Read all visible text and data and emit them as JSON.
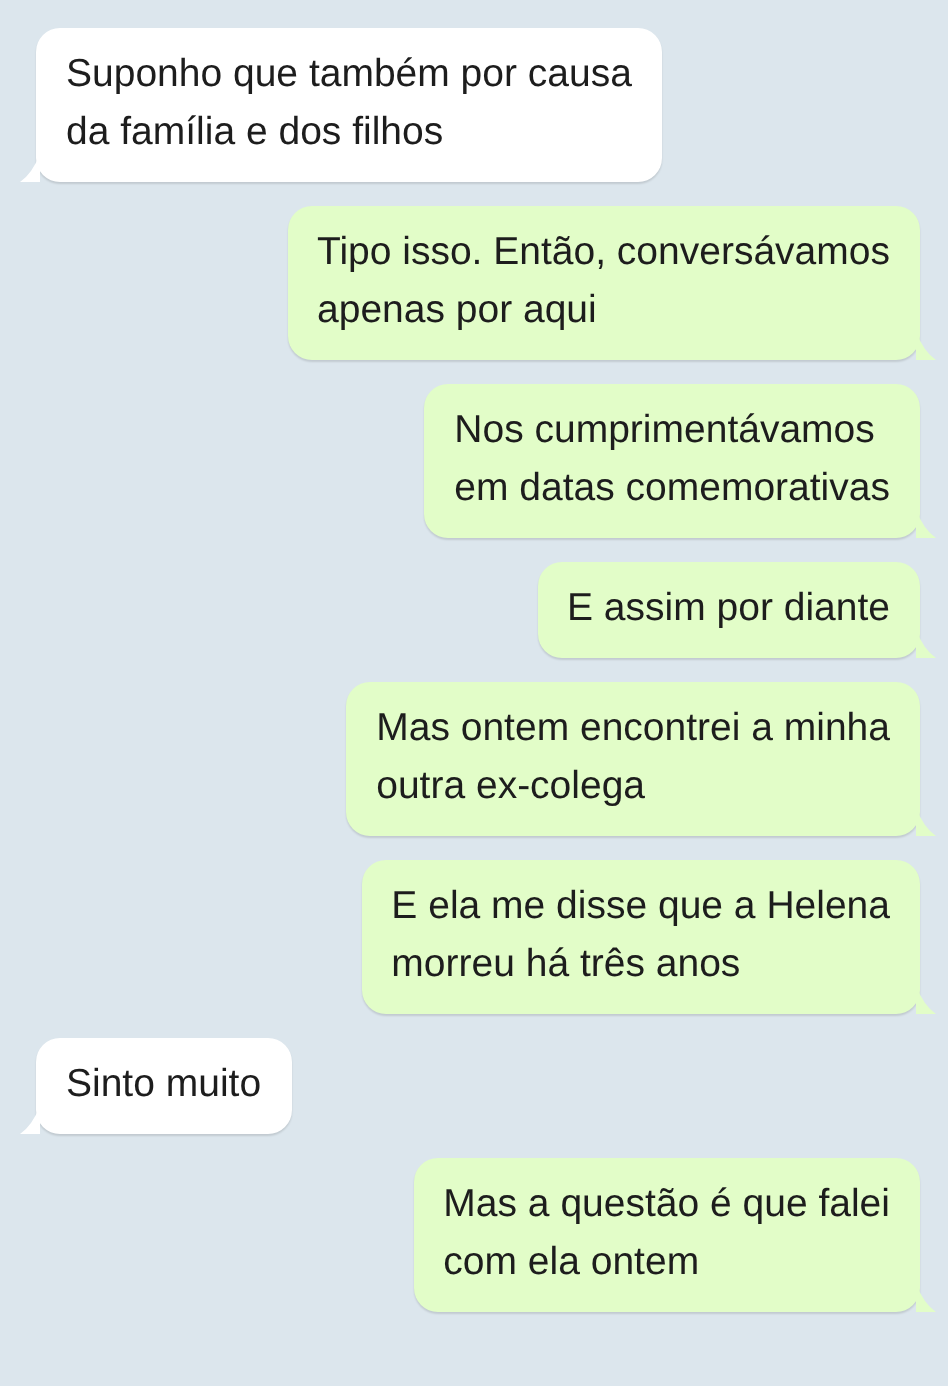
{
  "messages": [
    {
      "kind": "incoming",
      "text": "Suponho que também por causa\nda família e dos filhos"
    },
    {
      "kind": "outgoing",
      "text": "Tipo isso. Então, conversávamos\napenas por aqui"
    },
    {
      "kind": "outgoing",
      "text": "Nos cumprimentávamos\nem datas comemorativas"
    },
    {
      "kind": "outgoing",
      "text": "E assim por diante"
    },
    {
      "kind": "outgoing",
      "text": "Mas ontem encontrei a minha\noutra ex-colega"
    },
    {
      "kind": "outgoing",
      "text": "E ela me disse que a Helena\nmorreu há três anos"
    },
    {
      "kind": "incoming",
      "text": "Sinto muito"
    },
    {
      "kind": "outgoing",
      "text": "Mas a questão é que falei\ncom ela ontem"
    }
  ]
}
